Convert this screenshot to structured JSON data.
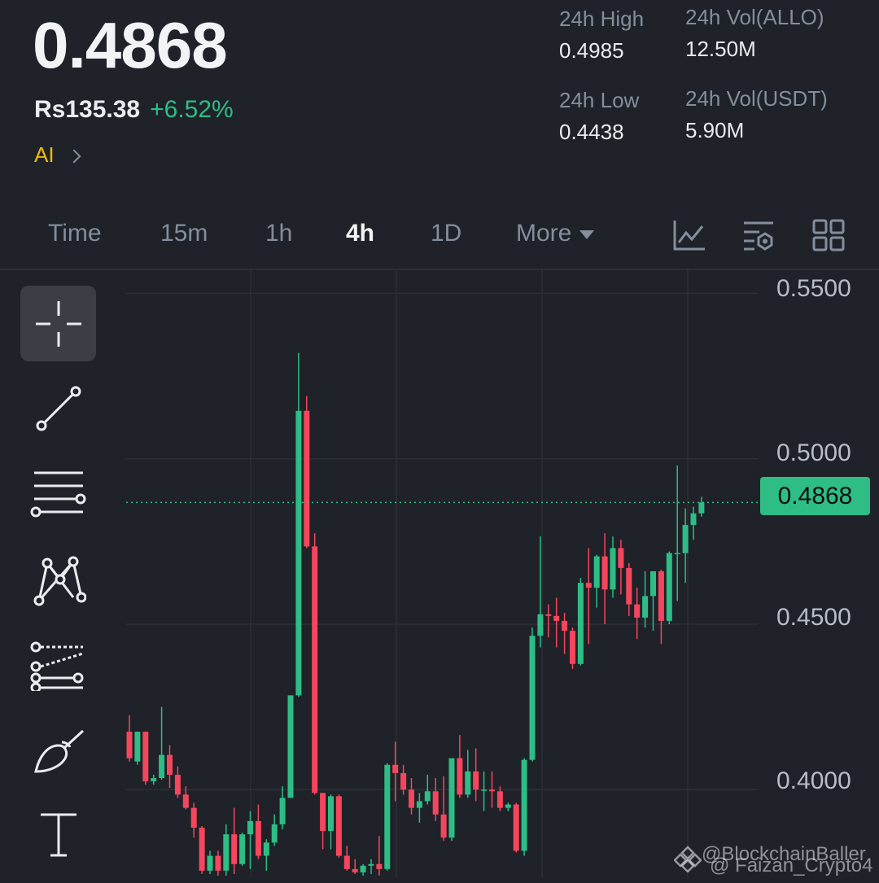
{
  "header": {
    "price": "0.4868",
    "fiat_price": "Rs135.38",
    "change": "+6.52%",
    "ai_label": "AI"
  },
  "stats": [
    {
      "label": "24h High",
      "value": "0.4985"
    },
    {
      "label": "24h Vol(ALLO)",
      "value": "12.50M"
    },
    {
      "label": "24h Low",
      "value": "0.4438"
    },
    {
      "label": "24h Vol(USDT)",
      "value": "5.90M"
    }
  ],
  "tabs": {
    "time": "Time",
    "m15": "15m",
    "h1": "1h",
    "h4": "4h",
    "d1": "1D",
    "more": "More",
    "active": "4h"
  },
  "toolbar_icons": [
    "indicator-chart-icon",
    "chart-settings-icon",
    "layout-grid-icon"
  ],
  "drawing_tools": [
    "crosshair-icon",
    "trend-line-icon",
    "horizontal-lines-icon",
    "pattern-icon",
    "fibonacci-channel-icon",
    "brush-icon",
    "text-tool-icon"
  ],
  "colors": {
    "background": "#1f2229",
    "up": "#2ebd85",
    "down": "#f6465d",
    "accent": "#f0b90b"
  },
  "watermark": {
    "line1": "@BlockchainBaller",
    "line2": "@ Faizan_Crypto4"
  },
  "chart_data": {
    "type": "candlestick",
    "y_ticks": [
      "0.5500",
      "0.5000",
      "0.4500",
      "0.4000"
    ],
    "ylim": [
      0.3735,
      0.557
    ],
    "last_price": "0.4868",
    "candles": [
      [
        0.4175,
        0.4225,
        0.4085,
        0.4095
      ],
      [
        0.4085,
        0.4175,
        0.4075,
        0.4175
      ],
      [
        0.4175,
        0.4175,
        0.4015,
        0.4025
      ],
      [
        0.4025,
        0.4045,
        0.4015,
        0.4035
      ],
      [
        0.4035,
        0.425,
        0.403,
        0.4105
      ],
      [
        0.4105,
        0.4135,
        0.4005,
        0.4045
      ],
      [
        0.4045,
        0.407,
        0.3975,
        0.3985
      ],
      [
        0.3985,
        0.401,
        0.394,
        0.3945
      ],
      [
        0.3945,
        0.396,
        0.3855,
        0.3885
      ],
      [
        0.3885,
        0.389,
        0.3745,
        0.3755
      ],
      [
        0.3755,
        0.3815,
        0.3745,
        0.38
      ],
      [
        0.38,
        0.3815,
        0.374,
        0.3755
      ],
      [
        0.3755,
        0.3895,
        0.374,
        0.3865
      ],
      [
        0.3865,
        0.3945,
        0.3745,
        0.3775
      ],
      [
        0.3775,
        0.387,
        0.377,
        0.3865
      ],
      [
        0.3865,
        0.3935,
        0.376,
        0.3905
      ],
      [
        0.3905,
        0.3955,
        0.379,
        0.38
      ],
      [
        0.38,
        0.385,
        0.3755,
        0.384
      ],
      [
        0.384,
        0.3925,
        0.383,
        0.3895
      ],
      [
        0.3895,
        0.401,
        0.388,
        0.3975
      ],
      [
        0.3975,
        0.4285,
        0.3975,
        0.4285
      ],
      [
        0.4285,
        0.532,
        0.428,
        0.5145
      ],
      [
        0.5145,
        0.519,
        0.473,
        0.4735
      ],
      [
        0.4735,
        0.4775,
        0.3985,
        0.399
      ],
      [
        0.399,
        0.399,
        0.382,
        0.3875
      ],
      [
        0.3875,
        0.3985,
        0.382,
        0.398
      ],
      [
        0.398,
        0.3985,
        0.3795,
        0.38
      ],
      [
        0.38,
        0.383,
        0.3755,
        0.376
      ],
      [
        0.376,
        0.379,
        0.3745,
        0.375
      ],
      [
        0.375,
        0.3775,
        0.374,
        0.377
      ],
      [
        0.377,
        0.379,
        0.3745,
        0.3775
      ],
      [
        0.3775,
        0.386,
        0.374,
        0.376
      ],
      [
        0.376,
        0.408,
        0.3755,
        0.4075
      ],
      [
        0.4075,
        0.4145,
        0.3965,
        0.405
      ],
      [
        0.405,
        0.4075,
        0.3985,
        0.4
      ],
      [
        0.4,
        0.4035,
        0.3925,
        0.3945
      ],
      [
        0.3945,
        0.399,
        0.39,
        0.3965
      ],
      [
        0.3965,
        0.4045,
        0.3955,
        0.3995
      ],
      [
        0.3995,
        0.4035,
        0.3905,
        0.3925
      ],
      [
        0.3925,
        0.404,
        0.3845,
        0.3855
      ],
      [
        0.3855,
        0.4045,
        0.3845,
        0.4095
      ],
      [
        0.4095,
        0.4165,
        0.3975,
        0.3985
      ],
      [
        0.3985,
        0.412,
        0.3975,
        0.4055
      ],
      [
        0.4055,
        0.4125,
        0.3965,
        0.4
      ],
      [
        0.4,
        0.4055,
        0.3935,
        0.4
      ],
      [
        0.4,
        0.4055,
        0.3945,
        0.3995
      ],
      [
        0.3995,
        0.401,
        0.3935,
        0.3945
      ],
      [
        0.3945,
        0.396,
        0.3935,
        0.3955
      ],
      [
        0.3955,
        0.396,
        0.381,
        0.3815
      ],
      [
        0.3815,
        0.4095,
        0.38,
        0.409
      ],
      [
        0.409,
        0.449,
        0.4085,
        0.4465
      ],
      [
        0.4465,
        0.4765,
        0.443,
        0.453
      ],
      [
        0.453,
        0.456,
        0.446,
        0.4525
      ],
      [
        0.4525,
        0.458,
        0.443,
        0.451
      ],
      [
        0.451,
        0.4535,
        0.441,
        0.448
      ],
      [
        0.448,
        0.449,
        0.4365,
        0.438
      ],
      [
        0.438,
        0.464,
        0.4375,
        0.4625
      ],
      [
        0.4625,
        0.473,
        0.444,
        0.461
      ],
      [
        0.461,
        0.471,
        0.455,
        0.4705
      ],
      [
        0.4705,
        0.4775,
        0.45,
        0.4605
      ],
      [
        0.4605,
        0.4765,
        0.458,
        0.473
      ],
      [
        0.473,
        0.4755,
        0.459,
        0.467
      ],
      [
        0.467,
        0.4685,
        0.4525,
        0.456
      ],
      [
        0.456,
        0.461,
        0.4455,
        0.452
      ],
      [
        0.452,
        0.466,
        0.449,
        0.4585
      ],
      [
        0.4585,
        0.466,
        0.448,
        0.466
      ],
      [
        0.466,
        0.4665,
        0.444,
        0.451
      ],
      [
        0.451,
        0.472,
        0.45,
        0.4715
      ],
      [
        0.4715,
        0.498,
        0.457,
        0.4715
      ],
      [
        0.4715,
        0.485,
        0.4625,
        0.48
      ],
      [
        0.48,
        0.4855,
        0.4755,
        0.4835
      ],
      [
        0.4835,
        0.4885,
        0.4825,
        0.4868
      ]
    ]
  }
}
